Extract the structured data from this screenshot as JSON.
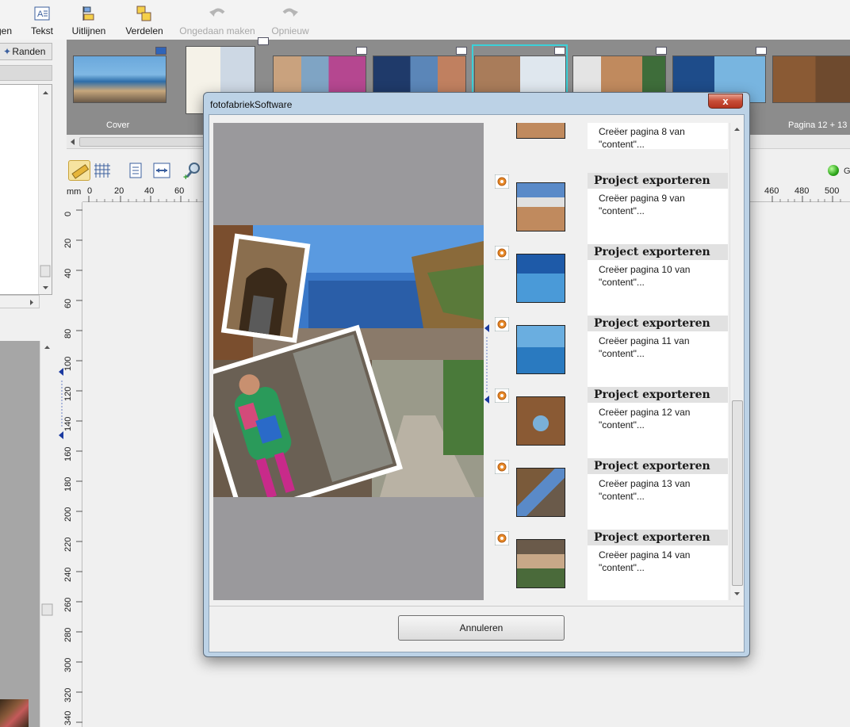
{
  "toolbar": {
    "left_cut": "gen",
    "tekst": "Tekst",
    "uitlijnen": "Uitlijnen",
    "verdelen": "Verdelen",
    "ongedaan": "Ongedaan maken",
    "opnieuw": "Opnieuw"
  },
  "left_panel": {
    "randen": "Randen"
  },
  "strip": {
    "cover_label": "Cover",
    "page_label": "Pagina 12 + 13"
  },
  "ruler": {
    "unit": "mm",
    "h_ticks": [
      "0",
      "20",
      "40",
      "60",
      "460",
      "480",
      "500"
    ],
    "v_ticks": [
      "0",
      "20",
      "40",
      "60",
      "80",
      "100",
      "120",
      "140",
      "160",
      "180",
      "200",
      "220",
      "240",
      "260",
      "280",
      "300",
      "320",
      "340"
    ]
  },
  "status": {
    "text": "G"
  },
  "dialog": {
    "title": "fotofabriekSoftware",
    "close": "x",
    "cancel": "Annuleren",
    "tasks": [
      {
        "heading": "",
        "text": "Creëer pagina 8 van \"content\"..."
      },
      {
        "heading": "Project exporteren",
        "text": "Creëer pagina 9 van \"content\"..."
      },
      {
        "heading": "Project exporteren",
        "text": "Creëer pagina 10 van \"content\"..."
      },
      {
        "heading": "Project exporteren",
        "text": "Creëer pagina 11 van \"content\"..."
      },
      {
        "heading": "Project exporteren",
        "text": "Creëer pagina 12 van \"content\"..."
      },
      {
        "heading": "Project exporteren",
        "text": "Creëer pagina 13 van \"content\"..."
      },
      {
        "heading": "Project exporteren",
        "text": "Creëer pagina 14 van \"content\"..."
      }
    ]
  },
  "colors": {
    "selection": "#3cd0d8",
    "close_button": "#c74d37",
    "preview_bg": "#9a999c"
  }
}
